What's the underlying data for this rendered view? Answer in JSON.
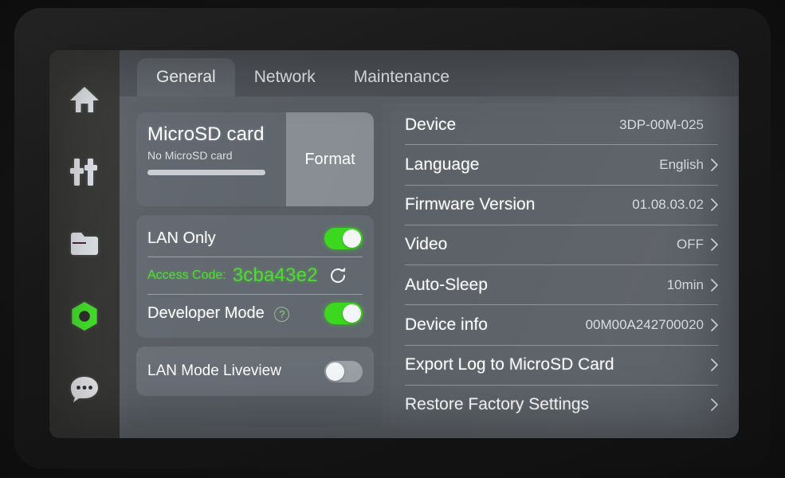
{
  "sidebar": {
    "items": [
      {
        "icon": "home-icon",
        "name": "home",
        "active": false
      },
      {
        "icon": "sliders-icon",
        "name": "controls",
        "active": false
      },
      {
        "icon": "folder-icon",
        "name": "files",
        "active": false
      },
      {
        "icon": "hex-nut-icon",
        "name": "settings",
        "active": true
      },
      {
        "icon": "chat-bubble-icon",
        "name": "messages",
        "active": false
      }
    ],
    "active_color": "#4ddc32"
  },
  "tabs": [
    {
      "label": "General",
      "active": true
    },
    {
      "label": "Network",
      "active": false
    },
    {
      "label": "Maintenance",
      "active": false
    }
  ],
  "left_panel": {
    "sd_card": {
      "title": "MicroSD card",
      "subtitle": "No MicroSD card",
      "format_label": "Format",
      "progress_percent": 0
    },
    "lan_only": {
      "label": "LAN Only",
      "enabled": true,
      "access_code_label": "Access Code:",
      "access_code_value": "3cba43e2",
      "access_code_color": "#4ddc32",
      "refresh_icon": "refresh-icon",
      "developer_mode_label": "Developer Mode",
      "developer_mode_help_icon": "help-circle-icon",
      "developer_mode_enabled": true
    },
    "liveview": {
      "label": "LAN Mode Liveview",
      "enabled": false
    }
  },
  "right_panel": {
    "rows": [
      {
        "label": "Device",
        "value": "3DP-00M-025",
        "chevron": false
      },
      {
        "label": "Language",
        "value": "English",
        "chevron": true
      },
      {
        "label": "Firmware Version",
        "value": "01.08.03.02",
        "chevron": true
      },
      {
        "label": "Video",
        "value": "OFF",
        "chevron": true
      },
      {
        "label": "Auto-Sleep",
        "value": "10min",
        "chevron": true
      },
      {
        "label": "Device info",
        "value": "00M00A242700020",
        "chevron": true
      },
      {
        "label": "Export Log to MicroSD Card",
        "value": "",
        "chevron": true
      },
      {
        "label": "Restore Factory Settings",
        "value": "",
        "chevron": true
      }
    ]
  }
}
